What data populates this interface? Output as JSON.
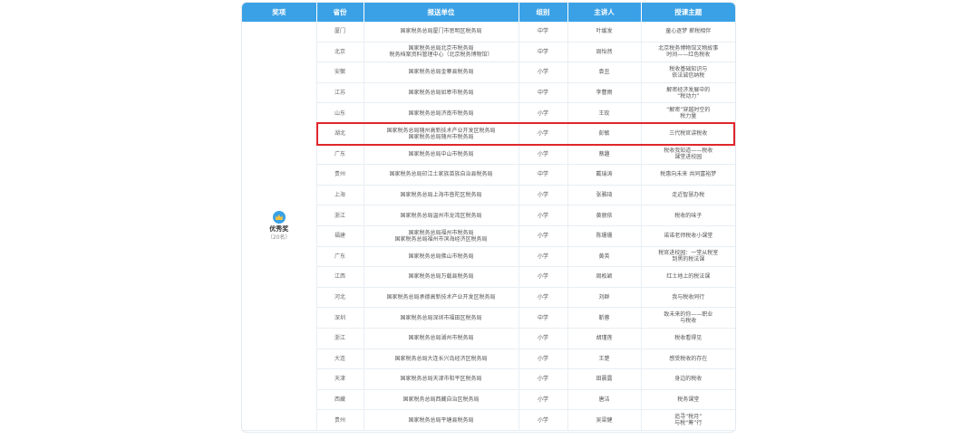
{
  "table": {
    "headers": [
      "奖项",
      "省份",
      "报送单位",
      "组别",
      "主讲人",
      "授课主题"
    ],
    "award": {
      "name": "优秀奖",
      "count": "（20名）"
    },
    "rows": [
      {
        "prov": "厦门",
        "unit": [
          "国家税务总局厦门市思明区税务局"
        ],
        "level": "中学",
        "speaker": "叶缓发",
        "topic": [
          "童心逐梦 薪税相伴"
        ]
      },
      {
        "prov": "北京",
        "unit": [
          "国家税务总局北京市税务局",
          "税务档案资料管理中心（北京税务博物馆）"
        ],
        "level": "中学",
        "speaker": "周怡然",
        "topic": [
          "北京税务博物馆文物故事",
          "时间——红色税收"
        ]
      },
      {
        "prov": "安徽",
        "unit": [
          "国家税务总局金寨县税务局"
        ],
        "level": "小学",
        "speaker": "袁丑",
        "topic": [
          "税收基础知识与",
          "依法诚信纳税"
        ]
      },
      {
        "prov": "江苏",
        "unit": [
          "国家税务总局如皋市税务局"
        ],
        "level": "中学",
        "speaker": "李曹雨",
        "topic": [
          "解密经济发展中的",
          "“税动力”"
        ]
      },
      {
        "prov": "山东",
        "unit": [
          "国家税务总局济南市税务局"
        ],
        "level": "小学",
        "speaker": "王玫",
        "topic": [
          "“解密”穿越时空的",
          "税力量"
        ]
      },
      {
        "prov": "湖北",
        "unit": [
          "国家税务总局随州高新技术产业开发区税务局",
          "国家税务总局随州市税务局"
        ],
        "level": "小学",
        "speaker": "彭敏",
        "topic": [
          "三代税官讲税收"
        ]
      },
      {
        "prov": "广东",
        "unit": [
          "国家税务总局中山市税务局"
        ],
        "level": "小学",
        "speaker": "蔡趣",
        "topic": [
          "税收我知道——税收",
          "课堂进校园"
        ]
      },
      {
        "prov": "贵州",
        "unit": [
          "国家税务总局印江土家族苗族自治县税务局"
        ],
        "level": "中学",
        "speaker": "戴瑞涛",
        "topic": [
          "税惠向未来 共同富裕梦"
        ]
      },
      {
        "prov": "上海",
        "unit": [
          "国家税务总局上海市普陀区税务局"
        ],
        "level": "小学",
        "speaker": "张雅琦",
        "topic": [
          "走近智慧办税"
        ]
      },
      {
        "prov": "浙江",
        "unit": [
          "国家税务总局温州市龙湾区税务局"
        ],
        "level": "小学",
        "speaker": "黄丽依",
        "topic": [
          "税收的味子"
        ]
      },
      {
        "prov": "福建",
        "unit": [
          "国家税务总局福州市税务局",
          "国家税务总局福州市滨海经济区税务局"
        ],
        "level": "小学",
        "speaker": "陈珊珊",
        "topic": [
          "诺诺老师税收小课堂"
        ]
      },
      {
        "prov": "广东",
        "unit": [
          "国家税务总局佛山市税务局"
        ],
        "level": "小学",
        "speaker": "黄英",
        "topic": [
          "税官进校园：一堂从税室",
          "到黑的税法课"
        ]
      },
      {
        "prov": "江西",
        "unit": [
          "国家税务总局万载县税务局"
        ],
        "level": "小学",
        "speaker": "周枚颖",
        "topic": [
          "红土地上的税法课"
        ]
      },
      {
        "prov": "河北",
        "unit": [
          "国家税务总局承德高新技术产业开发区税务局"
        ],
        "level": "小学",
        "speaker": "刘群",
        "topic": [
          "我与税收同行"
        ]
      },
      {
        "prov": "深圳",
        "unit": [
          "国家税务总局深圳市福田区税务局"
        ],
        "level": "中学",
        "speaker": "靳蓉",
        "topic": [
          "致未来的你——职业",
          "与税收"
        ]
      },
      {
        "prov": "浙江",
        "unit": [
          "国家税务总局湖州市税务局"
        ],
        "level": "小学",
        "speaker": "胡瑾莲",
        "topic": [
          "税收看得见"
        ]
      },
      {
        "prov": "大连",
        "unit": [
          "国家税务总局大连长兴岛经济区税务局"
        ],
        "level": "小学",
        "speaker": "王楚",
        "topic": [
          "感受税收的存在"
        ]
      },
      {
        "prov": "天津",
        "unit": [
          "国家税务总局天津市和平区税务局"
        ],
        "level": "小学",
        "speaker": "田晨露",
        "topic": [
          "身边的税收"
        ]
      },
      {
        "prov": "西藏",
        "unit": [
          "国家税务总局西藏自治区税务局"
        ],
        "level": "小学",
        "speaker": "唐洁",
        "topic": [
          "税务课堂"
        ]
      },
      {
        "prov": "贵州",
        "unit": [
          "国家税务总局平塘县税务局"
        ],
        "level": "小学",
        "speaker": "吴梁健",
        "topic": [
          "追寻“税月”",
          "与税“筹”行"
        ]
      }
    ]
  },
  "colors": {
    "header_bg": "#3aa1e6",
    "highlight_border": "#e0262b"
  }
}
